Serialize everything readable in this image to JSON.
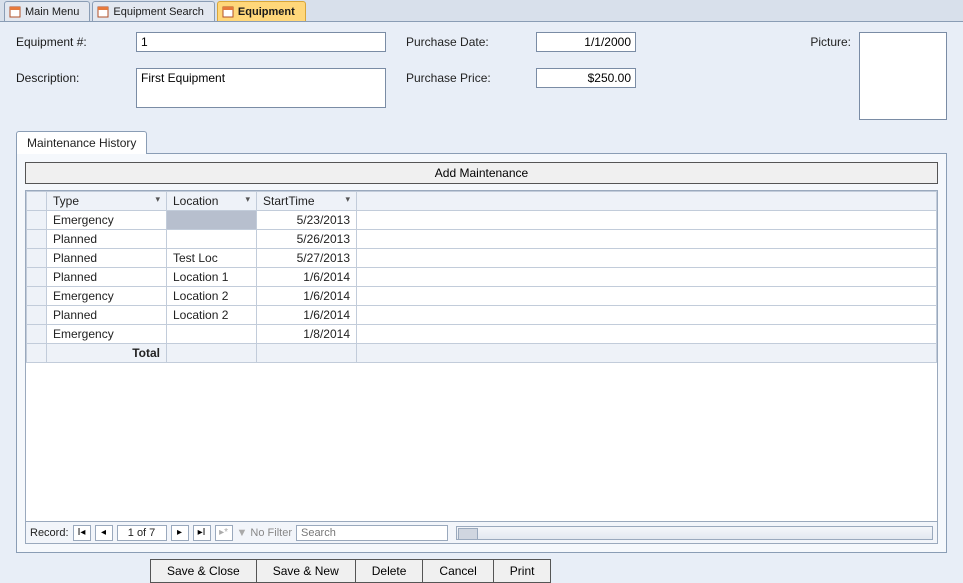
{
  "tabs": [
    {
      "label": "Main Menu",
      "active": false
    },
    {
      "label": "Equipment Search",
      "active": false
    },
    {
      "label": "Equipment",
      "active": true
    }
  ],
  "fields": {
    "equipment_num_label": "Equipment #:",
    "equipment_num_value": "1",
    "description_label": "Description:",
    "description_value": "First Equipment",
    "purchase_date_label": "Purchase Date:",
    "purchase_date_value": "1/1/2000",
    "purchase_price_label": "Purchase Price:",
    "purchase_price_value": "$250.00",
    "picture_label": "Picture:"
  },
  "subtab": {
    "label": "Maintenance History",
    "add_button": "Add Maintenance"
  },
  "grid": {
    "columns": [
      "Type",
      "Location",
      "StartTime"
    ],
    "rows": [
      {
        "type": "Emergency",
        "location": "",
        "starttime": "5/23/2013",
        "selected": true
      },
      {
        "type": "Planned",
        "location": "",
        "starttime": "5/26/2013"
      },
      {
        "type": "Planned",
        "location": "Test Loc",
        "starttime": "5/27/2013"
      },
      {
        "type": "Planned",
        "location": "Location 1",
        "starttime": "1/6/2014"
      },
      {
        "type": "Emergency",
        "location": "Location 2",
        "starttime": "1/6/2014"
      },
      {
        "type": "Planned",
        "location": "Location 2",
        "starttime": "1/6/2014"
      },
      {
        "type": "Emergency",
        "location": "",
        "starttime": "1/8/2014"
      }
    ],
    "total_label": "Total"
  },
  "recordnav": {
    "label": "Record:",
    "counter": "1 of 7",
    "filter_label": "No Filter",
    "search_placeholder": "Search"
  },
  "buttons": {
    "save_close": "Save & Close",
    "save_new": "Save & New",
    "delete": "Delete",
    "cancel": "Cancel",
    "print": "Print"
  }
}
